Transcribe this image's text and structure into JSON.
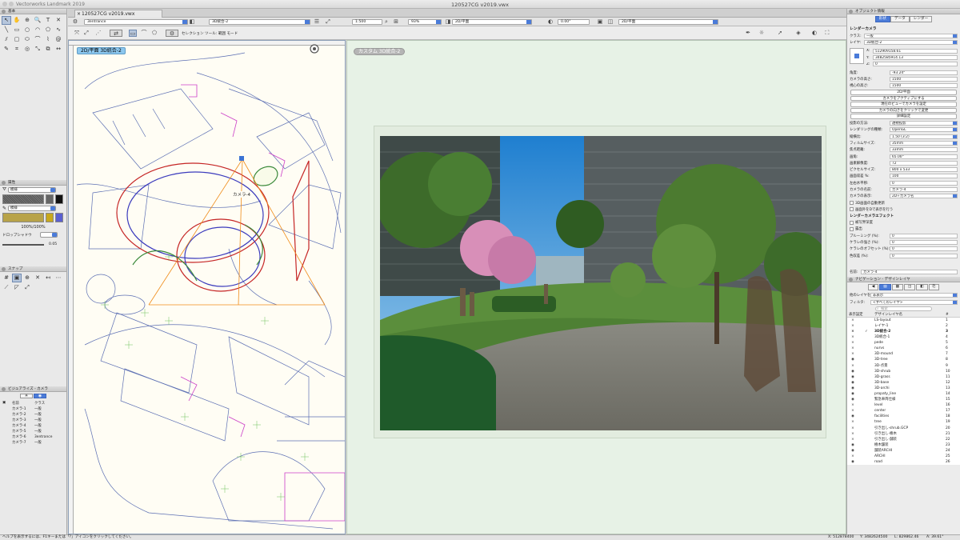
{
  "app": {
    "title": "Vectorworks Landmark 2019",
    "document": "120527CG v2019.vwx"
  },
  "tab": {
    "label": "120527CG v2019.vwx"
  },
  "palettes": {
    "basic": {
      "title": "基本"
    },
    "attributes": {
      "title": "属性",
      "fill_style": "模様",
      "pen_style": "模様",
      "opacity": "100%/100%",
      "drop_shadow": "ドロップシャドウ",
      "line_value": "0.05"
    },
    "snap": {
      "title": "スナップ"
    },
    "visualize": {
      "title": "ビジュアライズ - カメラ",
      "col_name": "名前",
      "col_class": "クラス",
      "rows": [
        {
          "name": "カメラ-1",
          "class": "一般"
        },
        {
          "name": "カメラ-2",
          "class": "一般"
        },
        {
          "name": "カメラ-3",
          "class": "一般"
        },
        {
          "name": "カメラ-4",
          "class": "一般"
        },
        {
          "name": "カメラ-5",
          "class": "一般"
        },
        {
          "name": "カメラ-6",
          "class": "3entrance"
        },
        {
          "name": "カメラ-7",
          "class": "一般"
        }
      ]
    }
  },
  "viewbar": {
    "class": "3entrance",
    "layer": "3D統合-2",
    "scale": "1:500",
    "zoom": "93%",
    "view": "2D/平面",
    "rotation": "0.00°",
    "view2": "2D/平面"
  },
  "modebar": {
    "mode_label": "セレクション ツール: 範囲 モード"
  },
  "plan": {
    "label": "2D/平面  3D統合-2",
    "camera_label": "カメラ-4"
  },
  "render": {
    "label": "カスタム 3D統合-2"
  },
  "oip": {
    "title": "オブジェクト情報",
    "tabs": [
      "形状",
      "データ",
      "レンダー"
    ],
    "heading": "レンダーカメラ",
    "class_label": "クラス:",
    "class_value": "一般",
    "layer_label": "レイヤ:",
    "layer_value": "3D統合-2",
    "x_label": "X:",
    "x_value": "512909158.61",
    "y_label": "Y:",
    "y_value": "3482585914.13",
    "z_label": "Z:",
    "z_value": "0",
    "fields": [
      {
        "label": "角度:",
        "value": "-93.24°"
      },
      {
        "label": "カメラの高さ:",
        "value": "1500"
      },
      {
        "label": "視心の高さ:",
        "value": "1500"
      }
    ],
    "buttons": [
      "2D/平面",
      "カメラをアクティブにする",
      "現在のビューでカメラを設定",
      "カメラの向きをクリックで変更",
      "詳細設定"
    ],
    "props": [
      {
        "label": "投影の方法:",
        "value": "透視投影",
        "select": true
      },
      {
        "label": "レンダリングの種類:",
        "value": "OpenGL",
        "select": true
      },
      {
        "label": "縦横比:",
        "value": "1.50 (3:2)",
        "select": true
      },
      {
        "label": "フィルムサイズ:",
        "value": "35mm",
        "select": true
      },
      {
        "label": "焦点距離:",
        "value": "33mm",
        "select": false
      },
      {
        "label": "画角:",
        "value": "65.00°",
        "select": false
      },
      {
        "label": "画素解像度:",
        "value": "72",
        "select": false
      },
      {
        "label": "ピクセルサイズ:",
        "value": "800 x 533",
        "select": false
      },
      {
        "label": "画面収差 %:",
        "value": "100",
        "select": false
      },
      {
        "label": "左右水平移:",
        "value": "0",
        "select": false
      },
      {
        "label": "カメラの名前:",
        "value": "カメラ-4",
        "select": false
      },
      {
        "label": "カメラの表示:",
        "value": "2D+カメラ名",
        "select": true
      }
    ],
    "checks": [
      "3D画面の自動更新",
      "画面外をDで表示を行う"
    ],
    "effects_heading": "レンダーカメラエフェクト",
    "effects_checks": [
      "被写界深度",
      "露出"
    ],
    "effects": [
      {
        "label": "ブルーミング (%):",
        "value": "0"
      },
      {
        "label": "ケラレの強さ (%):",
        "value": "0"
      },
      {
        "label": "ケラレのオフセット (%):",
        "value": "0"
      },
      {
        "label": "色収差 (%):",
        "value": "0"
      }
    ],
    "name_label": "名前:",
    "name_value": "カメラ-4"
  },
  "navigation": {
    "title": "ナビゲーション - デザインレイヤ",
    "sheet_label": "他のレイヤを:",
    "sheet_value": "非表示",
    "filter_label": "フィルタ:",
    "filter_value": "<すべてのレイヤ>",
    "search_placeholder": "検索",
    "col_visible": "表示設定",
    "col_name": "デザインレイヤ名",
    "col_num": "#",
    "layers": [
      {
        "name": "LS-layout",
        "num": "1",
        "vis": "×",
        "active": false
      },
      {
        "name": "レイヤ-1",
        "num": "2",
        "vis": "×",
        "active": false
      },
      {
        "name": "3D統合-2",
        "num": "3",
        "vis": "×",
        "active": true
      },
      {
        "name": "3D統合-1",
        "num": "4",
        "vis": "×",
        "active": false
      },
      {
        "name": "pede",
        "num": "5",
        "vis": "×",
        "active": false
      },
      {
        "name": "nurvs",
        "num": "6",
        "vis": "×",
        "active": false
      },
      {
        "name": "3D-mound",
        "num": "7",
        "vis": "×",
        "active": false
      },
      {
        "name": "3D-tree",
        "num": "8",
        "vis": "◉",
        "active": false
      },
      {
        "name": "3D-点景",
        "num": "9",
        "vis": "×",
        "active": false
      },
      {
        "name": "3D-shrub",
        "num": "10",
        "vis": "◉",
        "active": false
      },
      {
        "name": "3D-grass",
        "num": "11",
        "vis": "◉",
        "active": false
      },
      {
        "name": "3D-base",
        "num": "12",
        "vis": "◉",
        "active": false
      },
      {
        "name": "3D-archi",
        "num": "13",
        "vis": "◉",
        "active": false
      },
      {
        "name": "propaty_line",
        "num": "14",
        "vis": "◉",
        "active": false
      },
      {
        "name": "緊急車両仕様",
        "num": "15",
        "vis": "◉",
        "active": false
      },
      {
        "name": "level",
        "num": "16",
        "vis": "×",
        "active": false
      },
      {
        "name": "center",
        "num": "17",
        "vis": "×",
        "active": false
      },
      {
        "name": "facilities",
        "num": "18",
        "vis": "◉",
        "active": false
      },
      {
        "name": "tree",
        "num": "19",
        "vis": "×",
        "active": false
      },
      {
        "name": "引き出し-shrub.GCP",
        "num": "20",
        "vis": "×",
        "active": false
      },
      {
        "name": "引き出し-樹木",
        "num": "21",
        "vis": "×",
        "active": false
      },
      {
        "name": "引き出し-舗装",
        "num": "22",
        "vis": "×",
        "active": false
      },
      {
        "name": "樹木舗装",
        "num": "23",
        "vis": "◉",
        "active": false
      },
      {
        "name": "舗装ARCHI",
        "num": "24",
        "vis": "◉",
        "active": false
      },
      {
        "name": "ARCHI",
        "num": "25",
        "vis": "×",
        "active": false
      },
      {
        "name": "road",
        "num": "26",
        "vis": "◉",
        "active": false
      }
    ]
  },
  "status": {
    "hint": "ヘルプを表示するには、F1キーまたは「?」アイコンをクリックしてください。",
    "x": "X: 512878400",
    "y": "Y: 3482624500",
    "l": "L: 829862.46",
    "a": "A: 39.61°"
  }
}
